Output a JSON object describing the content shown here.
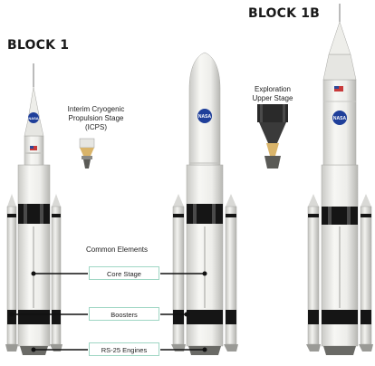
{
  "titles": {
    "block1": "BLOCK 1",
    "block1b": "BLOCK 1B"
  },
  "labels": {
    "icps_line1": "Interim Cryogenic",
    "icps_line2": "Propulsion Stage",
    "icps_line3": "(ICPS)",
    "eus_line1": "Exploration",
    "eus_line2": "Upper Stage",
    "common": "Common Elements"
  },
  "callouts": [
    "Core Stage",
    "Boosters",
    "RS-25 Engines"
  ],
  "nasa": "NASA",
  "colors": {
    "core": "#f4f4f1",
    "booster": "#e9e9e6",
    "black": "#151515",
    "accent": "#9fd6c4",
    "nasa_blue": "#1f3f9a"
  }
}
